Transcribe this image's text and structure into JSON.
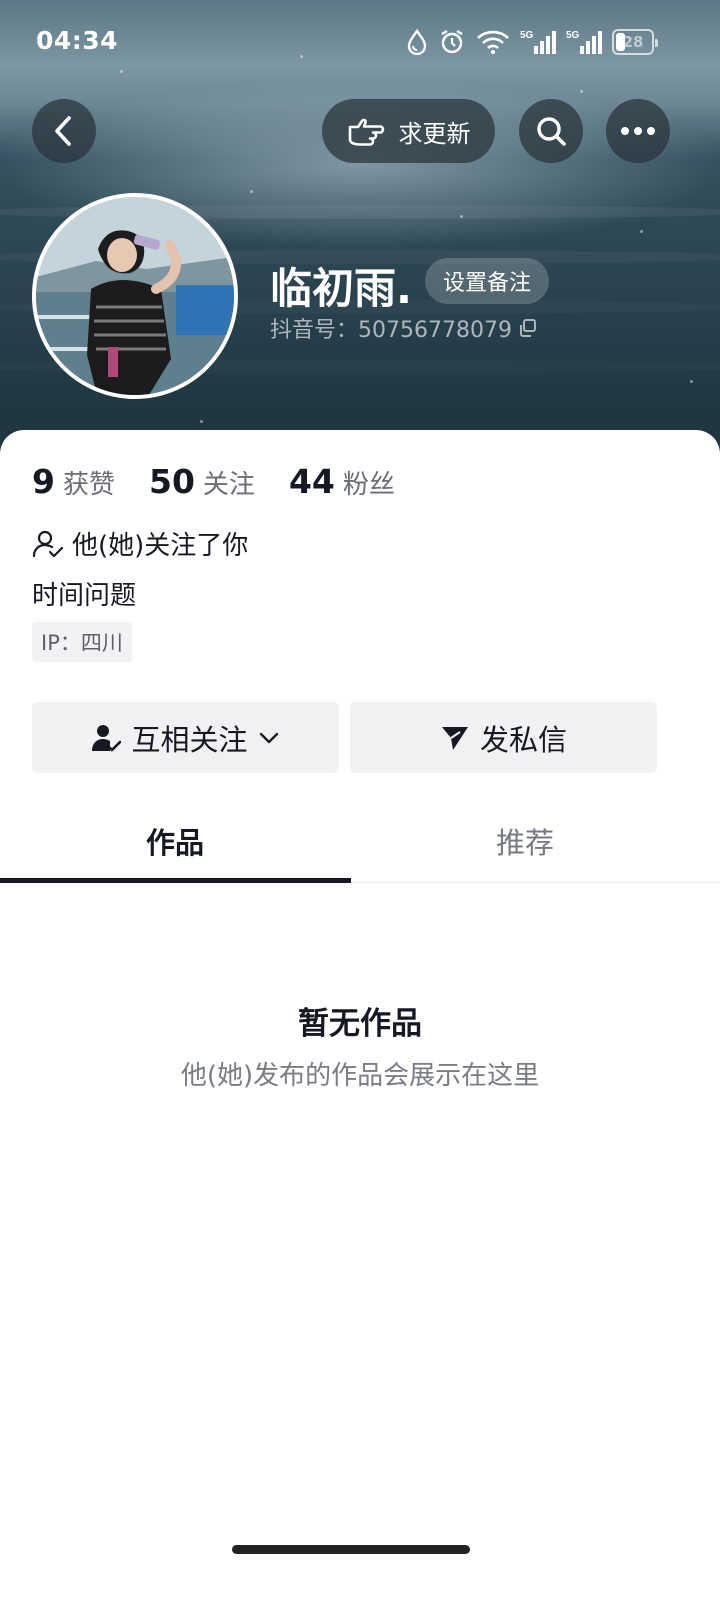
{
  "status_bar": {
    "time": "04:34",
    "battery": "28",
    "network_1": "5G",
    "network_2": "5G"
  },
  "header": {
    "request_update_label": "求更新",
    "back_icon": "chevron-left-icon",
    "search_icon": "search-icon",
    "more_icon": "more-dots-icon"
  },
  "profile": {
    "nickname": "临初雨.",
    "remark_button": "设置备注",
    "douyin_id": "抖音号：50756778079",
    "copy_icon": "copy-icon"
  },
  "stats": [
    {
      "value": "9",
      "label": "获赞"
    },
    {
      "value": "50",
      "label": "关注"
    },
    {
      "value": "44",
      "label": "粉丝"
    }
  ],
  "follow_note": "他(她)关注了你",
  "bio": "时间问题",
  "ip_location": "IP：四川",
  "actions": {
    "mutual_follow": "互相关注",
    "message": "发私信"
  },
  "tabs": [
    {
      "label": "作品",
      "active": true
    },
    {
      "label": "推荐",
      "active": false
    }
  ],
  "empty_state": {
    "title": "暂无作品",
    "subtitle": "他(她)发布的作品会展示在这里"
  },
  "colors": {
    "text_primary": "#161823",
    "text_secondary": "#6b6d77",
    "button_bg": "#f1f1f3",
    "banner_dark": "#223a45"
  }
}
